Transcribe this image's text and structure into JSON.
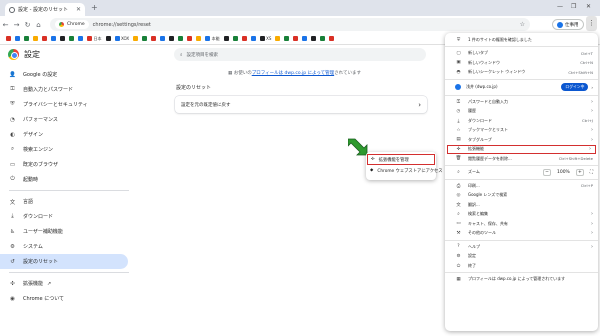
{
  "window": {
    "tab_title": "設定 - 設定のリセット",
    "new_tab": "+",
    "controls": [
      "—",
      "❐",
      "✕"
    ]
  },
  "toolbar": {
    "chip_label": "Chrome",
    "url": "chrome://settings/reset",
    "profile_label": "仕事用"
  },
  "bookmarks": [
    {
      "label": "",
      "color": "#d93025"
    },
    {
      "label": "",
      "color": "#1a73e8"
    },
    {
      "label": "",
      "color": "#188038"
    },
    {
      "label": "",
      "color": "#f9ab00"
    },
    {
      "label": "",
      "color": "#d93025"
    },
    {
      "label": "",
      "color": "#1a73e8"
    },
    {
      "label": "",
      "color": "#202124"
    },
    {
      "label": "",
      "color": "#188038"
    },
    {
      "label": "",
      "color": "#1a73e8"
    },
    {
      "label": "日本",
      "color": "#d93025"
    },
    {
      "label": "",
      "color": "#202124"
    },
    {
      "label": "XOX",
      "color": "#1a73e8"
    },
    {
      "label": "",
      "color": "#f9ab00"
    },
    {
      "label": "",
      "color": "#188038"
    },
    {
      "label": "",
      "color": "#d93025"
    },
    {
      "label": "",
      "color": "#1a73e8"
    },
    {
      "label": "",
      "color": "#202124"
    },
    {
      "label": "",
      "color": "#188038"
    },
    {
      "label": "",
      "color": "#d93025"
    },
    {
      "label": "",
      "color": "#f9ab00"
    },
    {
      "label": "本能",
      "color": "#1a73e8"
    },
    {
      "label": "",
      "color": "#202124"
    },
    {
      "label": "",
      "color": "#188038"
    },
    {
      "label": "",
      "color": "#d93025"
    },
    {
      "label": "",
      "color": "#1a73e8"
    },
    {
      "label": "XS",
      "color": "#202124"
    },
    {
      "label": "",
      "color": "#f9ab00"
    },
    {
      "label": "",
      "color": "#188038"
    },
    {
      "label": "",
      "color": "#d93025"
    },
    {
      "label": "",
      "color": "#1a73e8"
    },
    {
      "label": "",
      "color": "#202124"
    },
    {
      "label": "",
      "color": "#188038"
    },
    {
      "label": "",
      "color": "#d93025"
    }
  ],
  "settings": {
    "title": "設定",
    "search_placeholder": "設定項目を検索",
    "managed_prefix": "お使いの",
    "managed_link": "プロフィールは dwp.co.jp によって管理",
    "managed_suffix": "されています",
    "section_title": "設定のリセット",
    "card_label": "設定を元の既定値に戻す",
    "card_chevron": "›"
  },
  "sidebar": {
    "items": [
      {
        "icon": "person-icon",
        "glyph": "👤",
        "label": "Google の設定"
      },
      {
        "icon": "key-icon",
        "glyph": "⚿",
        "label": "自動入力とパスワード"
      },
      {
        "icon": "shield-icon",
        "glyph": "⛨",
        "label": "プライバシーとセキュリティ"
      },
      {
        "icon": "speedometer-icon",
        "glyph": "◔",
        "label": "パフォーマンス"
      },
      {
        "icon": "palette-icon",
        "glyph": "◐",
        "label": "デザイン"
      },
      {
        "icon": "search-icon",
        "glyph": "⌕",
        "label": "検索エンジン"
      },
      {
        "icon": "browser-icon",
        "glyph": "▭",
        "label": "既定のブラウザ"
      },
      {
        "icon": "power-icon",
        "glyph": "⏻",
        "label": "起動時"
      }
    ],
    "items2": [
      {
        "icon": "language-icon",
        "glyph": "文",
        "label": "言語"
      },
      {
        "icon": "download-icon",
        "glyph": "⤓",
        "label": "ダウンロード"
      },
      {
        "icon": "accessibility-icon",
        "glyph": "♿",
        "label": "ユーザー補助機能"
      },
      {
        "icon": "wrench-icon",
        "glyph": "⚙",
        "label": "システム"
      },
      {
        "icon": "reset-icon",
        "glyph": "↺",
        "label": "設定のリセット"
      }
    ],
    "items3": [
      {
        "icon": "puzzle-icon",
        "glyph": "✣",
        "label": "拡張機能"
      },
      {
        "icon": "chrome-icon",
        "glyph": "◉",
        "label": "Chrome について"
      }
    ],
    "extensions_external": "↗"
  },
  "popup": {
    "items": [
      {
        "label": "拡張機能を管理"
      },
      {
        "label": "Chrome ウェブストアにアクセス"
      }
    ]
  },
  "menu": {
    "header": "1 件のサイトの権限を確認しました",
    "group1": [
      {
        "label": "新しいタブ",
        "shortcut": "Ctrl+T"
      },
      {
        "label": "新しいウィンドウ",
        "shortcut": "Ctrl+N"
      },
      {
        "label": "新しいシークレット ウィンドウ",
        "shortcut": "Ctrl+Shift+N"
      }
    ],
    "profile_name": "浅井 (dwp.co.jp)",
    "profile_pill": "ログイン中",
    "group2": [
      {
        "label": "パスワードと自動入力",
        "shortcut": "",
        "chev": "›"
      },
      {
        "label": "履歴",
        "shortcut": "",
        "chev": "›"
      },
      {
        "label": "ダウンロード",
        "shortcut": "Ctrl+J",
        "chev": ""
      },
      {
        "label": "ブックマークとリスト",
        "shortcut": "",
        "chev": "›"
      },
      {
        "label": "タブグループ",
        "shortcut": "",
        "chev": "›"
      },
      {
        "label": "拡張機能",
        "shortcut": "",
        "chev": "›"
      },
      {
        "label": "閲覧履歴データを削除...",
        "shortcut": "Ctrl+Shift+Delete",
        "chev": ""
      }
    ],
    "zoom_label": "ズーム",
    "zoom_minus": "−",
    "zoom_value": "100%",
    "zoom_plus": "+",
    "zoom_full": "⛶",
    "group3": [
      {
        "label": "印刷...",
        "shortcut": "Ctrl+P",
        "chev": ""
      },
      {
        "label": "Google レンズで検索",
        "shortcut": "",
        "chev": ""
      },
      {
        "label": "翻訳...",
        "shortcut": "",
        "chev": ""
      },
      {
        "label": "検索と編集",
        "shortcut": "",
        "chev": "›"
      },
      {
        "label": "キャスト、保存、共有",
        "shortcut": "",
        "chev": "›"
      },
      {
        "label": "その他のツール",
        "shortcut": "",
        "chev": "›"
      }
    ],
    "group4": [
      {
        "label": "ヘルプ",
        "shortcut": "",
        "chev": "›"
      },
      {
        "label": "設定",
        "shortcut": "",
        "chev": ""
      },
      {
        "label": "終了",
        "shortcut": "",
        "chev": ""
      }
    ],
    "footer": "プロフィールは dwp.co.jp によって管理されています"
  }
}
